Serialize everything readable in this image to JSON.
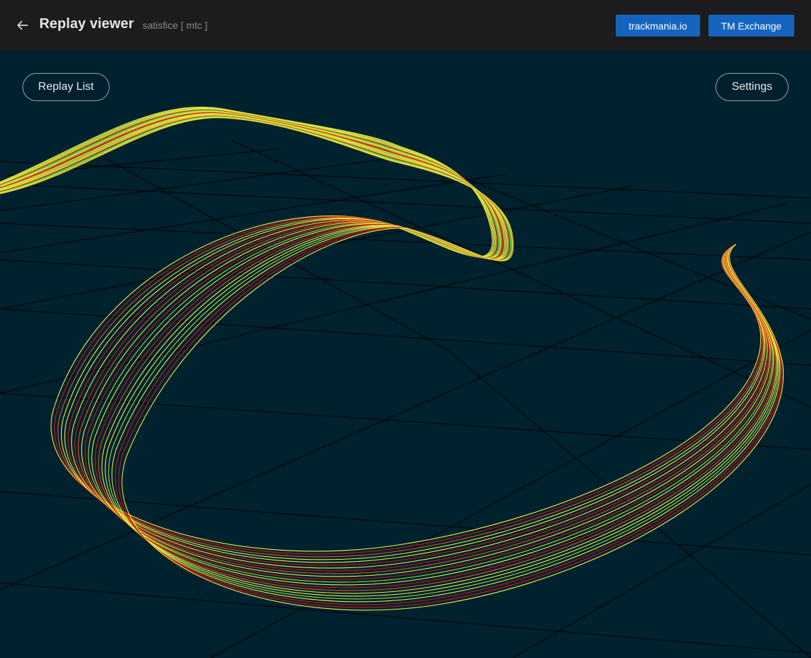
{
  "header": {
    "title": "Replay viewer",
    "subtitle": "satisfice [ mtc ]",
    "back_icon": "arrow-left-icon",
    "links": [
      {
        "label": "trackmania.io"
      },
      {
        "label": "TM Exchange"
      }
    ]
  },
  "viewer": {
    "replay_list_label": "Replay List",
    "settings_label": "Settings",
    "background_color": "#00212e",
    "grid_color": "#000000",
    "trace_colors": [
      "#3ee04a",
      "#9fe33a",
      "#f0f04a",
      "#f0c23a",
      "#e05a1e",
      "#d01a10"
    ]
  },
  "colors": {
    "header_bg": "#1c1c1e",
    "accent": "#1565c0"
  }
}
